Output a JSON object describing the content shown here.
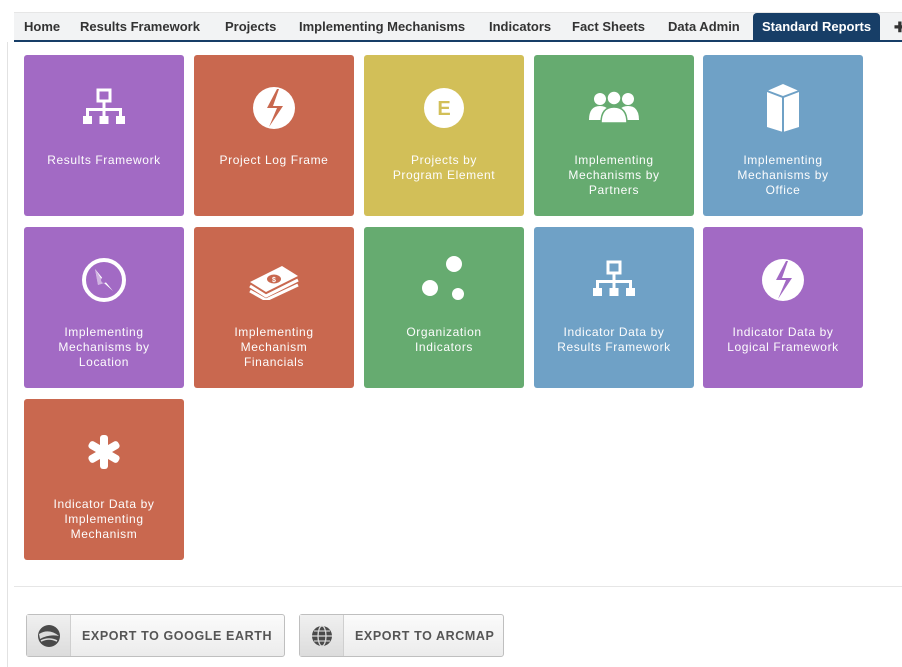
{
  "nav": {
    "items": [
      {
        "label": "Home"
      },
      {
        "label": "Results Framework"
      },
      {
        "label": "Projects"
      },
      {
        "label": "Implementing Mechanisms"
      },
      {
        "label": "Indicators"
      },
      {
        "label": "Fact Sheets"
      },
      {
        "label": "Data Admin"
      },
      {
        "label": "Standard Reports",
        "active": true
      }
    ],
    "more_glyph": "✚"
  },
  "tiles": [
    {
      "icon": "hierarchy-icon",
      "color": "#a26ac4",
      "lines": [
        "Results Framework"
      ]
    },
    {
      "icon": "logframe-icon",
      "color": "#c9684f",
      "lines": [
        "Project Log Frame"
      ]
    },
    {
      "icon": "program-element-icon",
      "color": "#d2bf58",
      "icon_letter": "E",
      "lines": [
        "Projects by",
        "Program Element"
      ]
    },
    {
      "icon": "partners-icon",
      "color": "#66ab70",
      "lines": [
        "Implementing",
        "Mechanisms by",
        "Partners"
      ]
    },
    {
      "icon": "office-building-icon",
      "color": "#6fa1c6",
      "lines": [
        "Implementing",
        "Mechanisms by",
        "Office"
      ]
    },
    {
      "icon": "compass-icon",
      "color": "#a26ac4",
      "lines": [
        "Implementing",
        "Mechanisms by",
        "Location"
      ]
    },
    {
      "icon": "money-icon",
      "color": "#c9684f",
      "lines": [
        "Implementing",
        "Mechanism",
        "Financials"
      ]
    },
    {
      "icon": "organization-dots-icon",
      "color": "#66ab70",
      "lines": [
        "Organization",
        "Indicators"
      ]
    },
    {
      "icon": "hierarchy-icon",
      "color": "#6fa1c6",
      "lines": [
        "Indicator Data by",
        "Results Framework"
      ]
    },
    {
      "icon": "logframe-icon",
      "color": "#a26ac4",
      "lines": [
        "Indicator Data by",
        "Logical Framework"
      ]
    },
    {
      "icon": "asterisk-icon",
      "color": "#c9684f",
      "lines": [
        "Indicator Data by",
        "Implementing",
        "Mechanism"
      ]
    }
  ],
  "export": {
    "google_earth_label": "EXPORT TO GOOGLE EARTH",
    "arcmap_label": "EXPORT TO ARCMAP"
  }
}
